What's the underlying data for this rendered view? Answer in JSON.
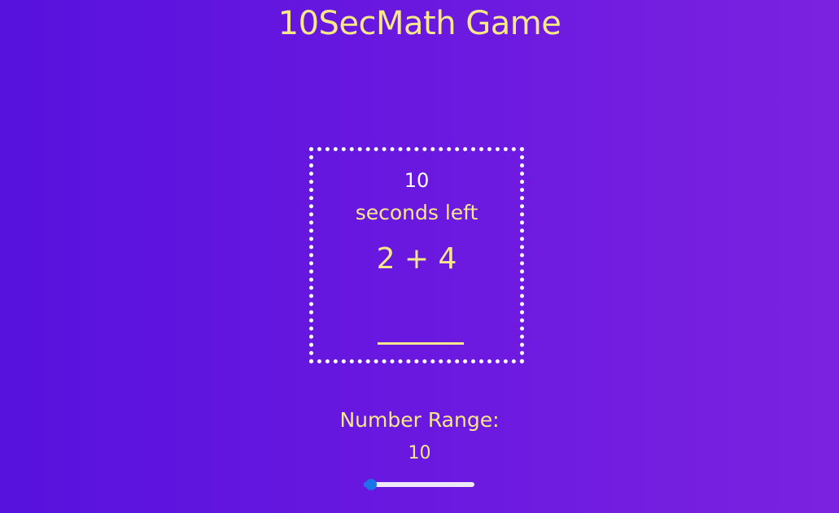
{
  "header": {
    "title": "10SecMath Game"
  },
  "game": {
    "timer_value": "10",
    "timer_label": "seconds left",
    "problem": "2 + 4",
    "answer_value": ""
  },
  "settings": {
    "range_label": "Number Range:",
    "range_value": "10",
    "slider": {
      "value": 10,
      "fill_fraction": 0.03
    }
  },
  "colors": {
    "background_start": "#5712dd",
    "background_end": "#7b22e0",
    "text_yellow": "#f5e88a",
    "timer_white": "#ffffff",
    "slider_accent": "#1a73e8"
  }
}
